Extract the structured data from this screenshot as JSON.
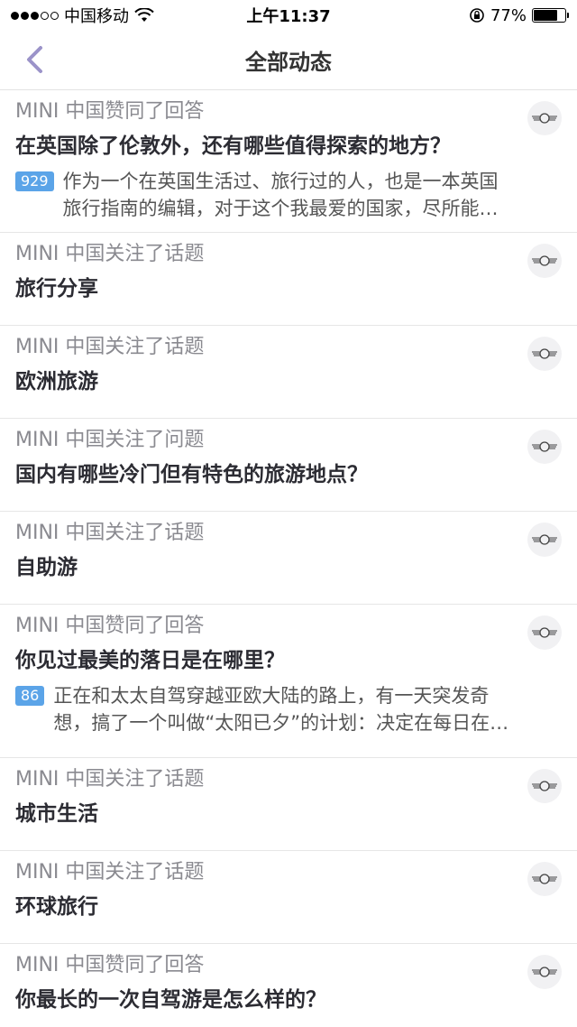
{
  "status_bar": {
    "carrier": "中国移动",
    "time": "上午11:37",
    "battery_percent_label": "77%",
    "battery_level": 0.77
  },
  "nav": {
    "title": "全部动态",
    "back_icon": "chevron-left-icon",
    "accent": "#9b93c9"
  },
  "feed": [
    {
      "activity": "MINI 中国赞同了回答",
      "title": "在英国除了伦敦外，还有哪些值得探索的地方？",
      "votes": "929",
      "excerpt": "作为一个在英国生活过、旅行过的人，也是一本英国旅行指南的编辑，对于这个我最爱的国家，尽所能把最…"
    },
    {
      "activity": "MINI 中国关注了话题",
      "title": "旅行分享"
    },
    {
      "activity": "MINI 中国关注了话题",
      "title": "欧洲旅游"
    },
    {
      "activity": "MINI 中国关注了问题",
      "title": "国内有哪些冷门但有特色的旅游地点？"
    },
    {
      "activity": "MINI 中国关注了话题",
      "title": "自助游"
    },
    {
      "activity": "MINI 中国赞同了回答",
      "title": "你见过最美的落日是在哪里？",
      "votes": "86",
      "excerpt": "正在和太太自驾穿越亚欧大陆的路上，有一天突发奇想，搞了一个叫做“太阳已夕”的计划：决定在每日在…"
    },
    {
      "activity": "MINI 中国关注了话题",
      "title": "城市生活"
    },
    {
      "activity": "MINI 中国关注了话题",
      "title": "环球旅行"
    },
    {
      "activity": "MINI 中国赞同了回答",
      "title": "你最长的一次自驾游是怎么样的？"
    }
  ],
  "colors": {
    "badge": "#5ba4e8",
    "activity_text": "#8a8a90"
  }
}
